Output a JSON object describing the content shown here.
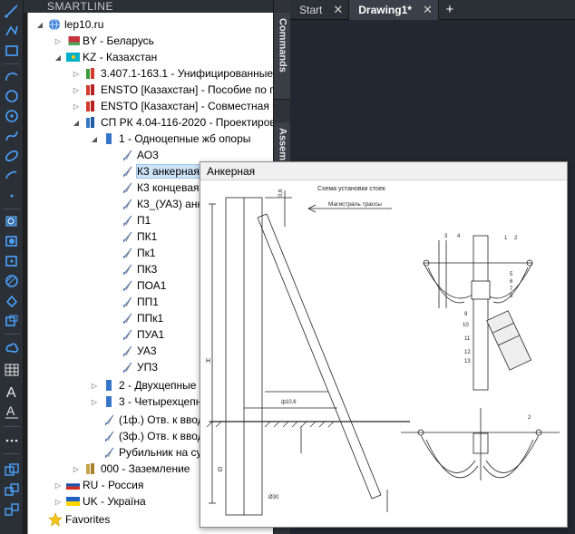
{
  "panel": {
    "title": "SMARTLINE"
  },
  "side_tabs": {
    "commands": "Commands",
    "assemblies": "Assem"
  },
  "doc_tabs": [
    {
      "label": "Start",
      "active": false
    },
    {
      "label": "Drawing1*",
      "active": true
    }
  ],
  "tree": {
    "root": "lep10.ru",
    "by": "BY - Беларусь",
    "kz": "KZ - Казахстан",
    "kz_1": "3.407.1-163.1 - Унифицированные ж",
    "kz_2": "ENSTO [Казахстан] - Пособие по про",
    "kz_3": "ENSTO [Казахстан] - Совместная по",
    "kz_4": "СП РК 4.04-116-2020 - Проектирован",
    "g1": "1 - Одноцепные жб опоры",
    "items": [
      "АО3",
      "К3 анкерная",
      "К3 концевая",
      "К3_(УА3) анк",
      "П1",
      "ПК1",
      "Пк1",
      "ПК3",
      "ПОА1",
      "ПП1",
      "ППк1",
      "ПУА1",
      "УА3",
      "УП3"
    ],
    "g2": "2 - Двухцепные ж",
    "g3": "3 - Четырехцепны",
    "o1": "(1ф.) Отв. к вводу",
    "o2": "(3ф.) Отв. к вводу",
    "o3": "Рубильник на суш",
    "zaz": "000 - Заземление",
    "ru": "RU - Россия",
    "ua": "UK - Україна",
    "fav": "Favorites"
  },
  "preview": {
    "title": "Анкерная",
    "scheme_title": "Схема установки стоек",
    "route_label": "Магистраль трассы",
    "dim_labels": [
      "0,6",
      "Н",
      "G",
      "ф10,6",
      "Ø30"
    ],
    "callouts": [
      "3",
      "1",
      "2",
      "4",
      "5",
      "6",
      "7",
      "8",
      "9",
      "10",
      "11",
      "12",
      "13",
      "2"
    ]
  }
}
